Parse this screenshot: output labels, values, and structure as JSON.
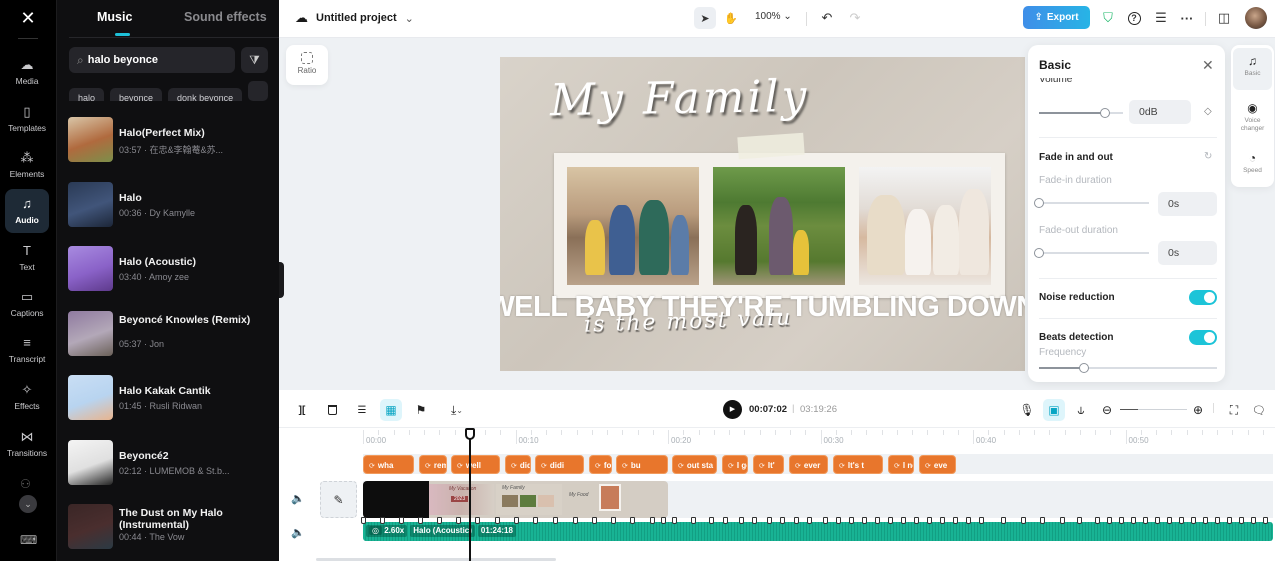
{
  "rail": {
    "logo": "capcut-logo",
    "items": [
      {
        "label": "Media",
        "icon": "cloud-upload-icon",
        "glyph": "☁"
      },
      {
        "label": "Templates",
        "icon": "templates-icon",
        "glyph": "▯"
      },
      {
        "label": "Elements",
        "icon": "elements-icon",
        "glyph": "⁂"
      },
      {
        "label": "Audio",
        "icon": "music-note-icon",
        "glyph": "♫",
        "active": true
      },
      {
        "label": "Text",
        "icon": "text-icon",
        "glyph": "T"
      },
      {
        "label": "Captions",
        "icon": "captions-icon",
        "glyph": "▭"
      },
      {
        "label": "Transcript",
        "icon": "transcript-icon",
        "glyph": "≡"
      },
      {
        "label": "Effects",
        "icon": "effects-icon",
        "glyph": "✧"
      },
      {
        "label": "Transitions",
        "icon": "transitions-icon",
        "glyph": "⋈"
      }
    ],
    "more_glyph": "⌄",
    "filter_glyph": "⚇",
    "keyboard_glyph": "⌨"
  },
  "panel": {
    "tabs": [
      {
        "label": "Music",
        "active": true
      },
      {
        "label": "Sound effects",
        "active": false
      }
    ],
    "search": {
      "value": "halo beyonce",
      "placeholder": "Search",
      "search_glyph": "⌕",
      "clear_glyph": "✕"
    },
    "filter_glyph": "⧩",
    "chips": [
      "halo",
      "beyonce",
      "donk beyonce",
      ""
    ],
    "tracks": [
      {
        "title": "Halo(Perfect Mix)",
        "duration": "03:57",
        "artist": "在忠&李翰菴&苏...",
        "thumb": [
          "#d9c6a8",
          "#b06a3e",
          "#7c8f4a"
        ]
      },
      {
        "title": "Halo",
        "duration": "00:36",
        "artist": "Dy Kamylle",
        "thumb": [
          "#2a3a55",
          "#41557a",
          "#1c2638"
        ]
      },
      {
        "title": "Halo (Acoustic)",
        "duration": "03:40",
        "artist": "Amoy zee",
        "thumb": [
          "#a88be0",
          "#8a62c8",
          "#5e3a8c"
        ]
      },
      {
        "title": "Beyoncé Knowles (Remix)",
        "duration": "05:37",
        "artist": "Jon",
        "thumb": [
          "#8f7aa0",
          "#b3a8b8",
          "#6a6058"
        ]
      },
      {
        "title": "Halo Kakak Cantik",
        "duration": "01:45",
        "artist": "Rusli Ridwan",
        "thumb": [
          "#c9def4",
          "#b8d4f0",
          "#e8b48e"
        ]
      },
      {
        "title": "Beyoncé2",
        "duration": "02:12",
        "artist": "LUMEMOB & St.b...",
        "thumb": [
          "#f4f4f4",
          "#e0e0e0",
          "#222222"
        ]
      },
      {
        "title": "The Dust on My Halo (Instrumental)",
        "duration": "00:44",
        "artist": "The Vow",
        "thumb": [
          "#3a2626",
          "#4a2e2e",
          "#2b3a44"
        ]
      }
    ]
  },
  "topbar": {
    "cloud_glyph": "☁",
    "project_title": "Untitled project",
    "chevron": "⌄",
    "select_glyph": "➤",
    "hand_glyph": "✋",
    "zoom_level": "100%",
    "undo_glyph": "↶",
    "redo_glyph": "↷",
    "export_label": "Export",
    "export_glyph": "⇪",
    "shield_glyph": "⛉",
    "help_glyph": "?",
    "stack_glyph": "☰",
    "more_glyph": "···",
    "layout_glyph": "◫"
  },
  "canvas": {
    "ratio_label": "Ratio",
    "preview": {
      "title_text": "My Family",
      "caption": "WELL BABY THEY'RE TUMBLING DOWN",
      "underlay_text": "is the most valu"
    }
  },
  "properties": {
    "title": "Basic",
    "close_glyph": "✕",
    "volume_label": "Volume",
    "volume_value": "0dB",
    "volume_level": 0.78,
    "keyframe_glyph": "◇",
    "fade_heading": "Fade in and out",
    "reset_glyph": "↻",
    "fade_in_label": "Fade-in duration",
    "fade_in_value": "0s",
    "fade_in_level": 0,
    "fade_out_label": "Fade-out duration",
    "fade_out_value": "0s",
    "fade_out_level": 0,
    "noise_reduction_label": "Noise reduction",
    "noise_reduction_on": true,
    "beats_label": "Beats detection",
    "beats_on": true,
    "frequency_label": "Frequency",
    "frequency_level": 0.25,
    "tabs": [
      {
        "label": "Basic",
        "glyph": "♫",
        "active": true
      },
      {
        "label": "Voice changer",
        "glyph": "◉",
        "active": false
      },
      {
        "label": "Speed",
        "glyph": "◔",
        "active": false
      }
    ]
  },
  "timeline_toolbar": {
    "split_glyph": "][",
    "delete_glyph": "🗑",
    "auto_caption_glyph": "☰",
    "freeze_glyph": "▦",
    "marker_glyph": "⚑",
    "download_glyph": "⤓",
    "play_glyph": "▶",
    "current_time": "00:07:02",
    "separator": "|",
    "total_time": "03:19:26",
    "mic_glyph": "🎙",
    "magnet_glyph": "▣",
    "link_glyph": "⫝",
    "zoom_out_glyph": "⊖",
    "zoom_in_glyph": "⊕",
    "fullscreen_glyph": "⛶",
    "feedback_glyph": "🗨",
    "zoom_level": 0.27
  },
  "timeline": {
    "ruler_labels": [
      "00:00",
      "00:10",
      "00:20",
      "00:30",
      "00:40",
      "00:50"
    ],
    "caption_clips": [
      "wha",
      "rem",
      "well",
      "didi",
      "didi",
      "fou",
      "bu",
      "out sta",
      "I go",
      "It'",
      "ever",
      "It's t",
      "I ne",
      "eve"
    ],
    "caption_glyph": "⟳",
    "cover_edit_glyph": "✎",
    "mute_glyph": "🔈",
    "audio": {
      "speed": "2.60x",
      "name": "Halo (Acoustic)",
      "duration": "01:24:18",
      "speed_glyph": "◎"
    },
    "video_thumb_texts": [
      "My Vacation",
      "2023",
      "My Family",
      "My Food"
    ]
  }
}
